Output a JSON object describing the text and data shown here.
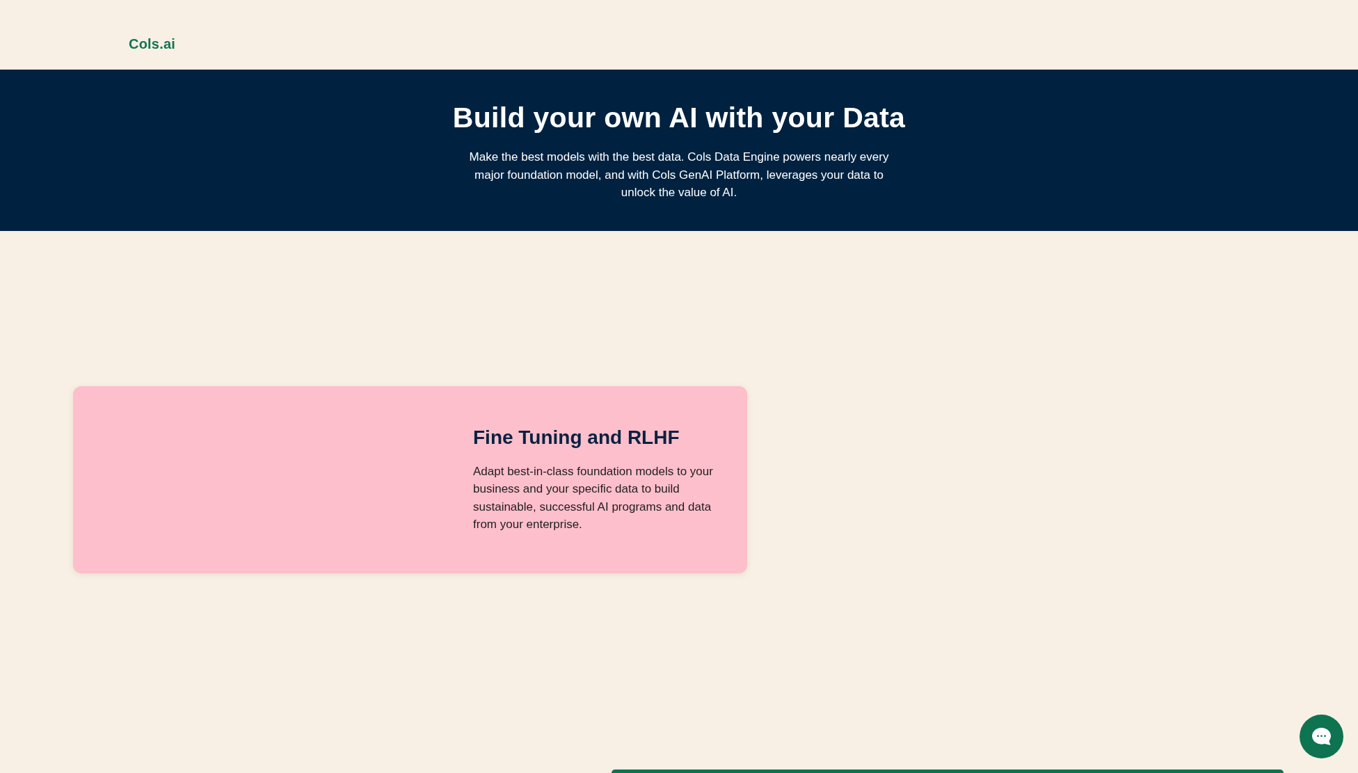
{
  "header": {
    "logo": "Cols.ai"
  },
  "hero": {
    "title": "Build your own AI with your Data",
    "description": "Make the best models with the best data. Cols Data Engine powers nearly every major foundation model, and with Cols GenAI Platform, leverages your data to unlock the value of AI."
  },
  "feature_card": {
    "title": "Fine Tuning and RLHF",
    "description": "Adapt best-in-class foundation models to your business and your specific data to build sustainable, successful AI programs and data from your enterprise."
  }
}
